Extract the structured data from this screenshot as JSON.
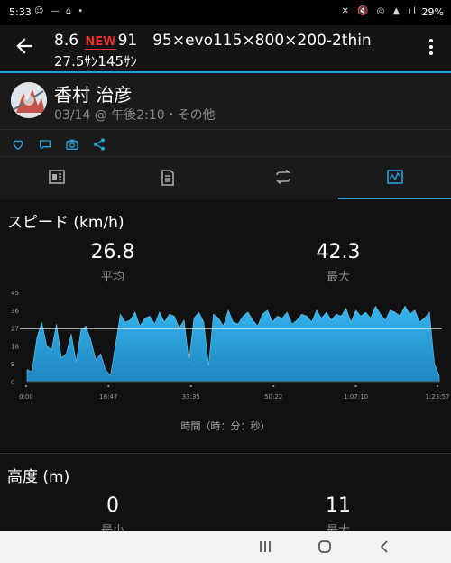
{
  "status": {
    "time": "5:33",
    "left_icons": "☺ — ⌂ •",
    "right_icons": "✕ 🔇 ◎ ▲ ıl",
    "battery": "29%"
  },
  "activity": {
    "title_part1": "8.6",
    "title_badge": "NEW",
    "title_part2": "91　95×evo115×800×200-2thin",
    "title_line2": "27.5ｻﾝ145ｻﾝ"
  },
  "author": {
    "name": "香村 治彦",
    "meta": "03/14 @ 午後2:10・その他"
  },
  "speed": {
    "title": "スピード (km/h)",
    "avg_value": "26.8",
    "avg_label": "平均",
    "max_value": "42.3",
    "max_label": "最大",
    "xlabel": "時間（時：分：秒）"
  },
  "altitude": {
    "title": "高度 (m)",
    "min_value": "0",
    "min_label": "最小",
    "max_value": "11",
    "max_label": "最大"
  },
  "chart_data": {
    "type": "area",
    "title": "スピード (km/h)",
    "xlabel": "時間（時：分：秒）",
    "x_ticks": [
      "0:00",
      "16:47",
      "33:35",
      "50:22",
      "1:07:10",
      "1:23:57"
    ],
    "y_ticks": [
      "0",
      "9",
      "18",
      "27",
      "36",
      "45"
    ],
    "ylim": [
      0,
      45
    ],
    "average_line": 26.8,
    "x_minutes": [
      0,
      1,
      2,
      3,
      4,
      5,
      6,
      7,
      8,
      9,
      10,
      11,
      12,
      13,
      14,
      15,
      16,
      17,
      18,
      19,
      20,
      21,
      22,
      23,
      24,
      25,
      26,
      27,
      28,
      29,
      30,
      31,
      32,
      33,
      34,
      35,
      36,
      37,
      38,
      39,
      40,
      41,
      42,
      43,
      44,
      45,
      46,
      47,
      48,
      49,
      50,
      51,
      52,
      53,
      54,
      55,
      56,
      57,
      58,
      59,
      60,
      61,
      62,
      63,
      64,
      65,
      66,
      67,
      68,
      69,
      70,
      71,
      72,
      73,
      74,
      75,
      76,
      77,
      78,
      79,
      80,
      81,
      82,
      83,
      84
    ],
    "y_speed": [
      6,
      5,
      22,
      30,
      18,
      16,
      29,
      12,
      14,
      24,
      10,
      26,
      28,
      21,
      11,
      14,
      6,
      3,
      18,
      34,
      30,
      31,
      35,
      28,
      32,
      33,
      29,
      35,
      30,
      34,
      33,
      27,
      31,
      10,
      32,
      35,
      30,
      8,
      34,
      32,
      28,
      36,
      30,
      29,
      33,
      35,
      31,
      28,
      34,
      36,
      30,
      33,
      32,
      35,
      29,
      31,
      34,
      33,
      30,
      36,
      32,
      35,
      31,
      34,
      33,
      37,
      30,
      36,
      33,
      35,
      32,
      38,
      34,
      31,
      36,
      35,
      33,
      38,
      34,
      36,
      30,
      32,
      35,
      9,
      3
    ]
  },
  "tabs": [
    "summary",
    "details",
    "laps",
    "charts"
  ],
  "colors": {
    "accent": "#2aa0dc",
    "area": "#2c9fd6",
    "badge": "#e8322e"
  }
}
